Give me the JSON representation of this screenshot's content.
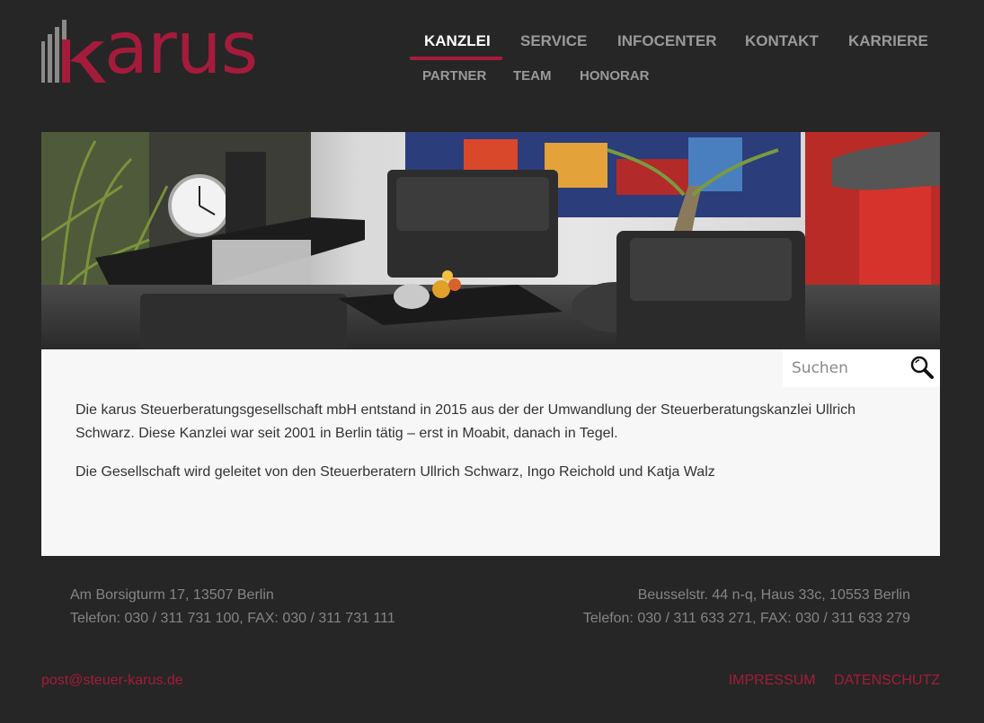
{
  "logo": {
    "text": "karus",
    "brand_color": "#a51b3b"
  },
  "nav": {
    "main": [
      {
        "label": "KANZLEI",
        "active": true
      },
      {
        "label": "SERVICE"
      },
      {
        "label": "INFOCENTER"
      },
      {
        "label": "KONTAKT"
      },
      {
        "label": "KARRIERE"
      }
    ],
    "sub": [
      {
        "label": "PARTNER"
      },
      {
        "label": "TEAM"
      },
      {
        "label": "HONORAR"
      }
    ]
  },
  "search": {
    "placeholder": "Suchen",
    "icon": "magnifier-icon"
  },
  "content": {
    "paragraphs": [
      "Die karus Steuerberatungsgesellschaft mbH entstand in 2015 aus der der Umwandlung der Steuerberatungskanzlei Ullrich Schwarz. Diese Kanzlei war seit 2001 in Berlin tätig – erst in Moabit, danach in Tegel.",
      "Die Gesellschaft wird geleitet von den Steuerberatern Ullrich Schwarz, Ingo Reichold und Katja Walz"
    ]
  },
  "footer": {
    "office_left": {
      "address": "Am Borsigturm 17, 13507 Berlin",
      "phone": "Telefon: 030 / 311 731 100, FAX: 030 / 311 731 111"
    },
    "office_right": {
      "address": "Beusselstr. 44 n-q, Haus 33c, 10553 Berlin",
      "phone": "Telefon: 030 / 311 633 271, FAX: 030 / 311 633 279"
    },
    "email": "post@steuer-karus.de",
    "links": [
      "IMPRESSUM",
      "DATENSCHUTZ"
    ]
  }
}
